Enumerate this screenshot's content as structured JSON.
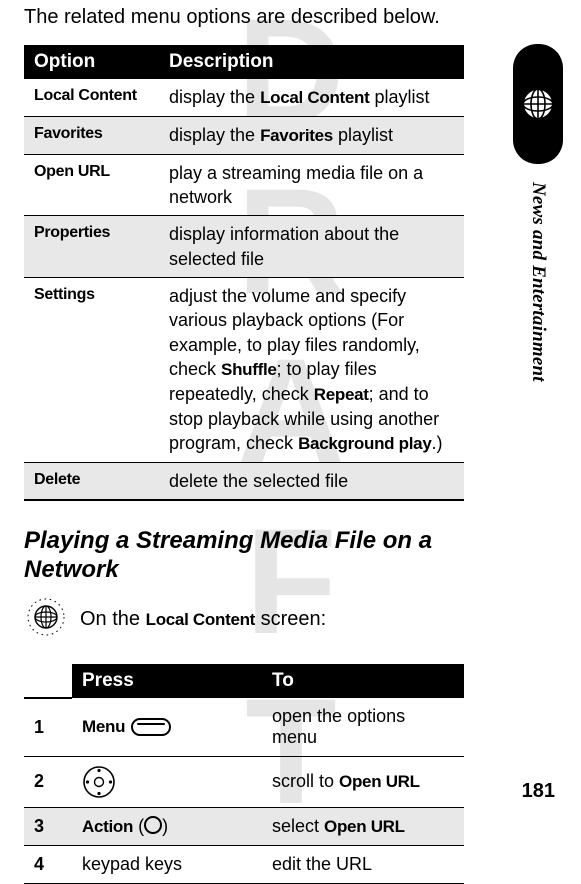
{
  "watermark": "DRAFT",
  "intro": "The related menu options are described below.",
  "options_table": {
    "headers": {
      "option": "Option",
      "description": "Description"
    },
    "rows": [
      {
        "name": "Local Content",
        "desc_pre": "display the ",
        "desc_bold": "Local Content",
        "desc_post": " playlist"
      },
      {
        "name": "Favorites",
        "desc_pre": "display the ",
        "desc_bold": "Favorites",
        "desc_post": " playlist"
      },
      {
        "name": "Open URL",
        "desc_pre": "play a streaming media file on a network",
        "desc_bold": "",
        "desc_post": ""
      },
      {
        "name": "Properties",
        "desc_pre": "display information about the selected file",
        "desc_bold": "",
        "desc_post": ""
      },
      {
        "name": "Settings",
        "desc_pre": "adjust the volume and specify various playback options (For example, to play files randomly, check ",
        "desc_bold": "Shuffle",
        "desc_post": "; to play files repeatedly, check ",
        "desc_bold2": "Repeat",
        "desc_post2": "; and to stop playback while using another program, check ",
        "desc_bold3": "Background play",
        "desc_post3": ".)"
      },
      {
        "name": "Delete",
        "desc_pre": "delete the selected file",
        "desc_bold": "",
        "desc_post": ""
      }
    ]
  },
  "section_heading": "Playing a Streaming Media File on a Network",
  "lead_pre": "On the ",
  "lead_bold": "Local Content",
  "lead_post": " screen:",
  "steps_table": {
    "headers": {
      "press": "Press",
      "to": "To"
    },
    "rows": [
      {
        "n": "1",
        "press_bold": "Menu",
        "press_bold2": "",
        "to_pre": "open the options menu",
        "to_bold": "",
        "to_post": ""
      },
      {
        "n": "2",
        "press_bold": "",
        "press_bold2": "",
        "to_pre": "scroll to ",
        "to_bold": "Open URL",
        "to_post": ""
      },
      {
        "n": "3",
        "press_bold": "Action",
        "press_bold2": "",
        "to_pre": "select ",
        "to_bold": "Open URL",
        "to_post": ""
      },
      {
        "n": "4",
        "press_plain": "keypad keys",
        "to_pre": "edit the URL",
        "to_bold": "",
        "to_post": ""
      }
    ]
  },
  "side": {
    "section": "News and Entertainment"
  },
  "page_number": "181"
}
